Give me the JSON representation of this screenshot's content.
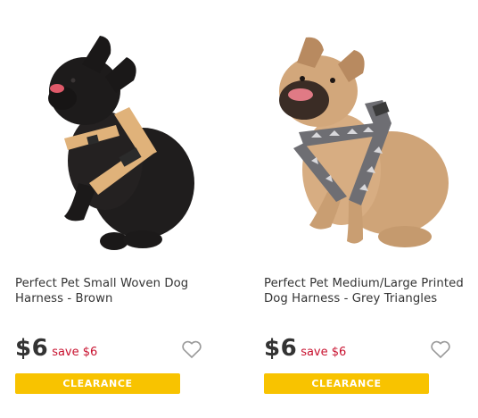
{
  "products": [
    {
      "title": "Perfect Pet Small Woven Dog Harness - Brown",
      "price": "$6",
      "save": "save $6",
      "badge": "CLEARANCE",
      "dog_color": "#1f1d1d",
      "harness_color": "#e0b27a"
    },
    {
      "title": "Perfect Pet Medium/Large Printed Dog Harness - Grey Triangles",
      "price": "$6",
      "save": "save $6",
      "badge": "CLEARANCE",
      "dog_color": "#cfa478",
      "harness_color": "#6e6e73"
    }
  ],
  "colors": {
    "badge": "#f8c300",
    "save_text": "#c8102e",
    "text": "#333333",
    "wishlist_outline": "#9a9a9a"
  },
  "icons": {
    "wishlist": "heart-outline-icon"
  }
}
